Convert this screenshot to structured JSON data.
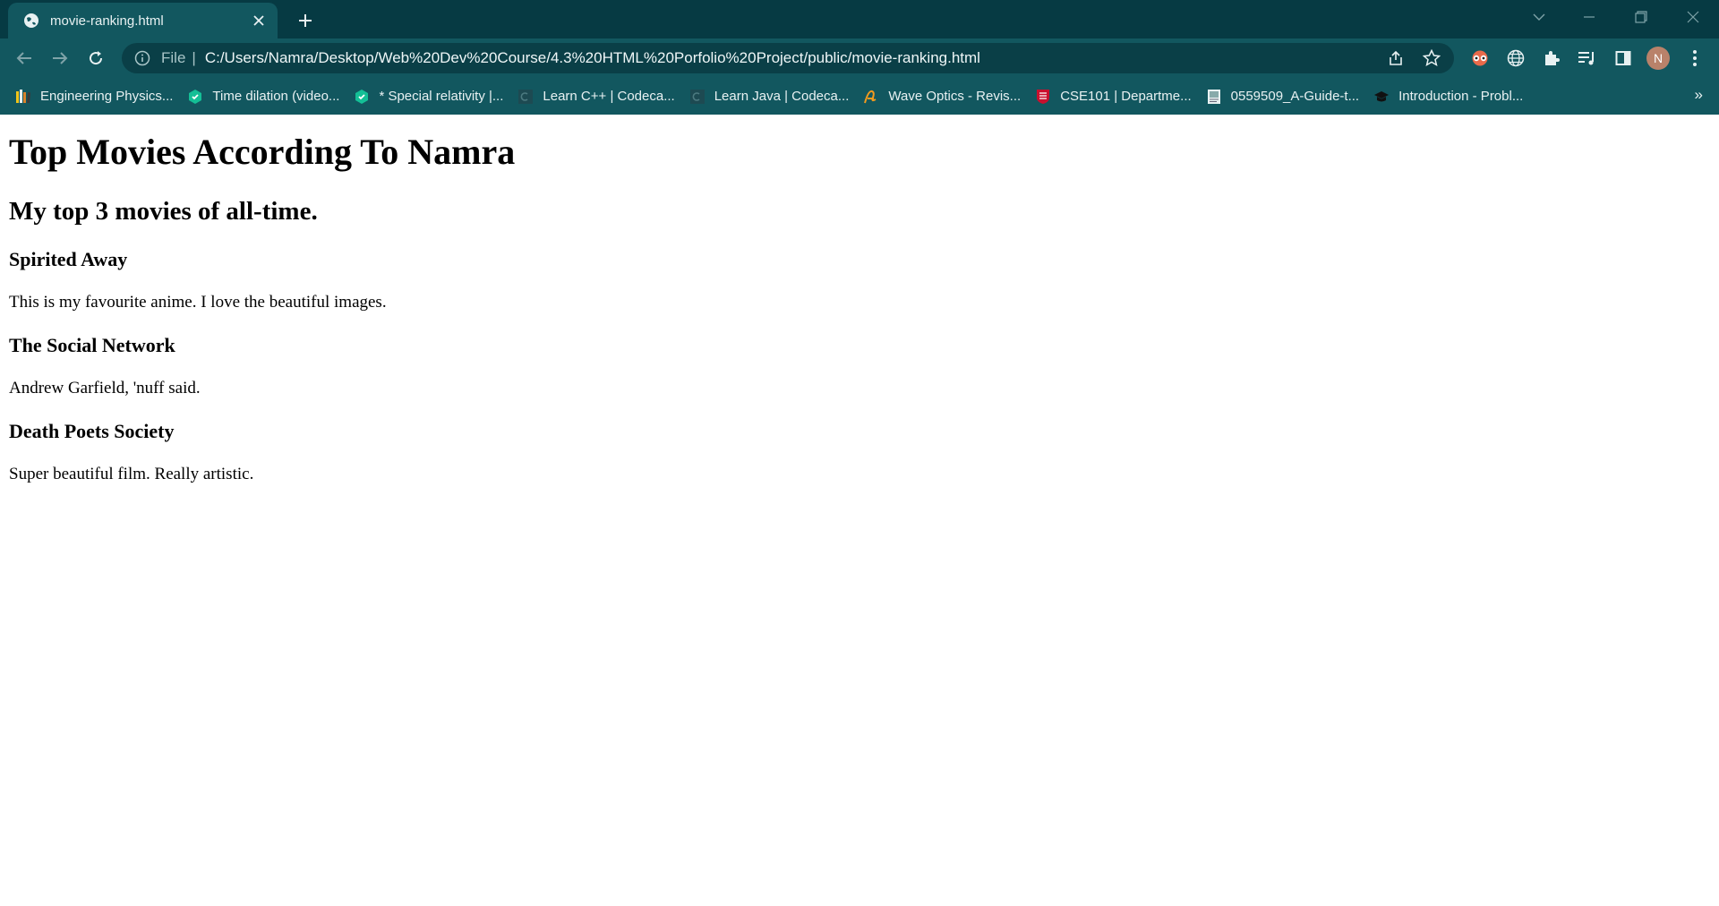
{
  "tab": {
    "title": "movie-ranking.html"
  },
  "omnibox": {
    "scheme": "File",
    "url": "C:/Users/Namra/Desktop/Web%20Dev%20Course/4.3%20HTML%20Porfolio%20Project/public/movie-ranking.html"
  },
  "profile": {
    "initial": "N"
  },
  "bookmarks": [
    {
      "label": "Engineering Physics...",
      "icon": "books-icon"
    },
    {
      "label": "Time dilation (video...",
      "icon": "khan-academy-icon"
    },
    {
      "label": "* Special relativity |...",
      "icon": "khan-academy-icon"
    },
    {
      "label": "Learn C++ | Codeca...",
      "icon": "codecademy-icon"
    },
    {
      "label": "Learn Java | Codeca...",
      "icon": "codecademy-icon"
    },
    {
      "label": "Wave Optics - Revis...",
      "icon": "a-logo-icon"
    },
    {
      "label": "CSE101 | Departme...",
      "icon": "shield-icon"
    },
    {
      "label": "0559509_A-Guide-t...",
      "icon": "document-icon"
    },
    {
      "label": "Introduction - Probl...",
      "icon": "graduation-cap-icon"
    }
  ],
  "page": {
    "heading": "Top Movies According To Namra",
    "subheading": "My top 3 movies of all-time.",
    "movies": [
      {
        "title": "Spirited Away",
        "description": "This is my favourite anime. I love the beautiful images."
      },
      {
        "title": "The Social Network",
        "description": "Andrew Garfield, 'nuff said."
      },
      {
        "title": "Death Poets Society",
        "description": "Super beautiful film. Really artistic."
      }
    ]
  },
  "colors": {
    "tabstrip": "#063a43",
    "toolbar": "#12575f",
    "omnibox": "#0a3f47",
    "avatar": "#b9826a"
  }
}
